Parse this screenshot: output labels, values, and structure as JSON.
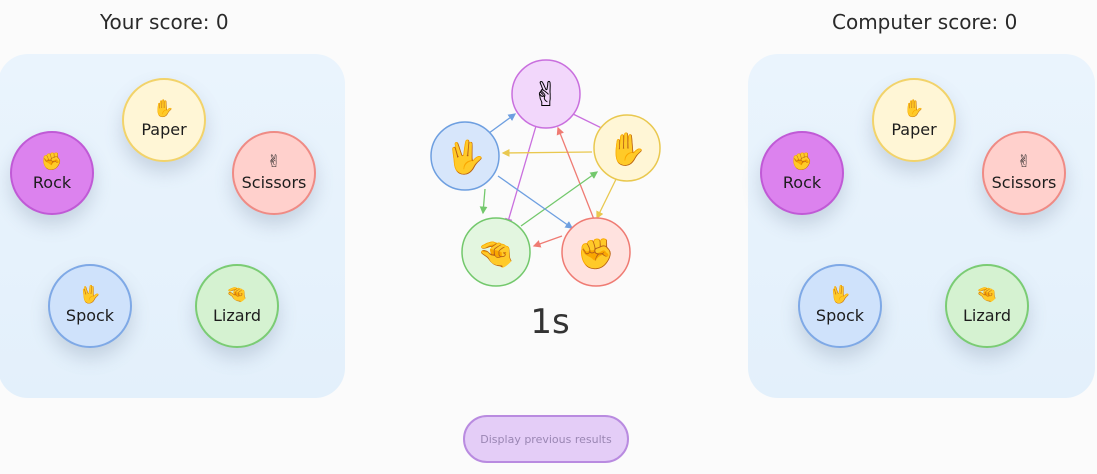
{
  "scores": {
    "player_label": "Your score: 0",
    "computer_label": "Computer score: 0"
  },
  "moves": {
    "paper": "Paper",
    "rock": "Rock",
    "scissors": "Scissors",
    "spock": "Spock",
    "lizard": "Lizard"
  },
  "icons": {
    "paper": "✋",
    "rock": "✊",
    "scissors": "✌",
    "spock": "🖖",
    "lizard": "🤏"
  },
  "timer": "1s",
  "history_button": "Display previous results",
  "colors": {
    "rock": "#dc82ee",
    "paper": "#fff6d6",
    "scissors": "#ffd0cc",
    "spock": "#cfe2fb",
    "lizard": "#d5f2d1",
    "panel": "#e6f2fc",
    "button": "#e4cdf7"
  }
}
